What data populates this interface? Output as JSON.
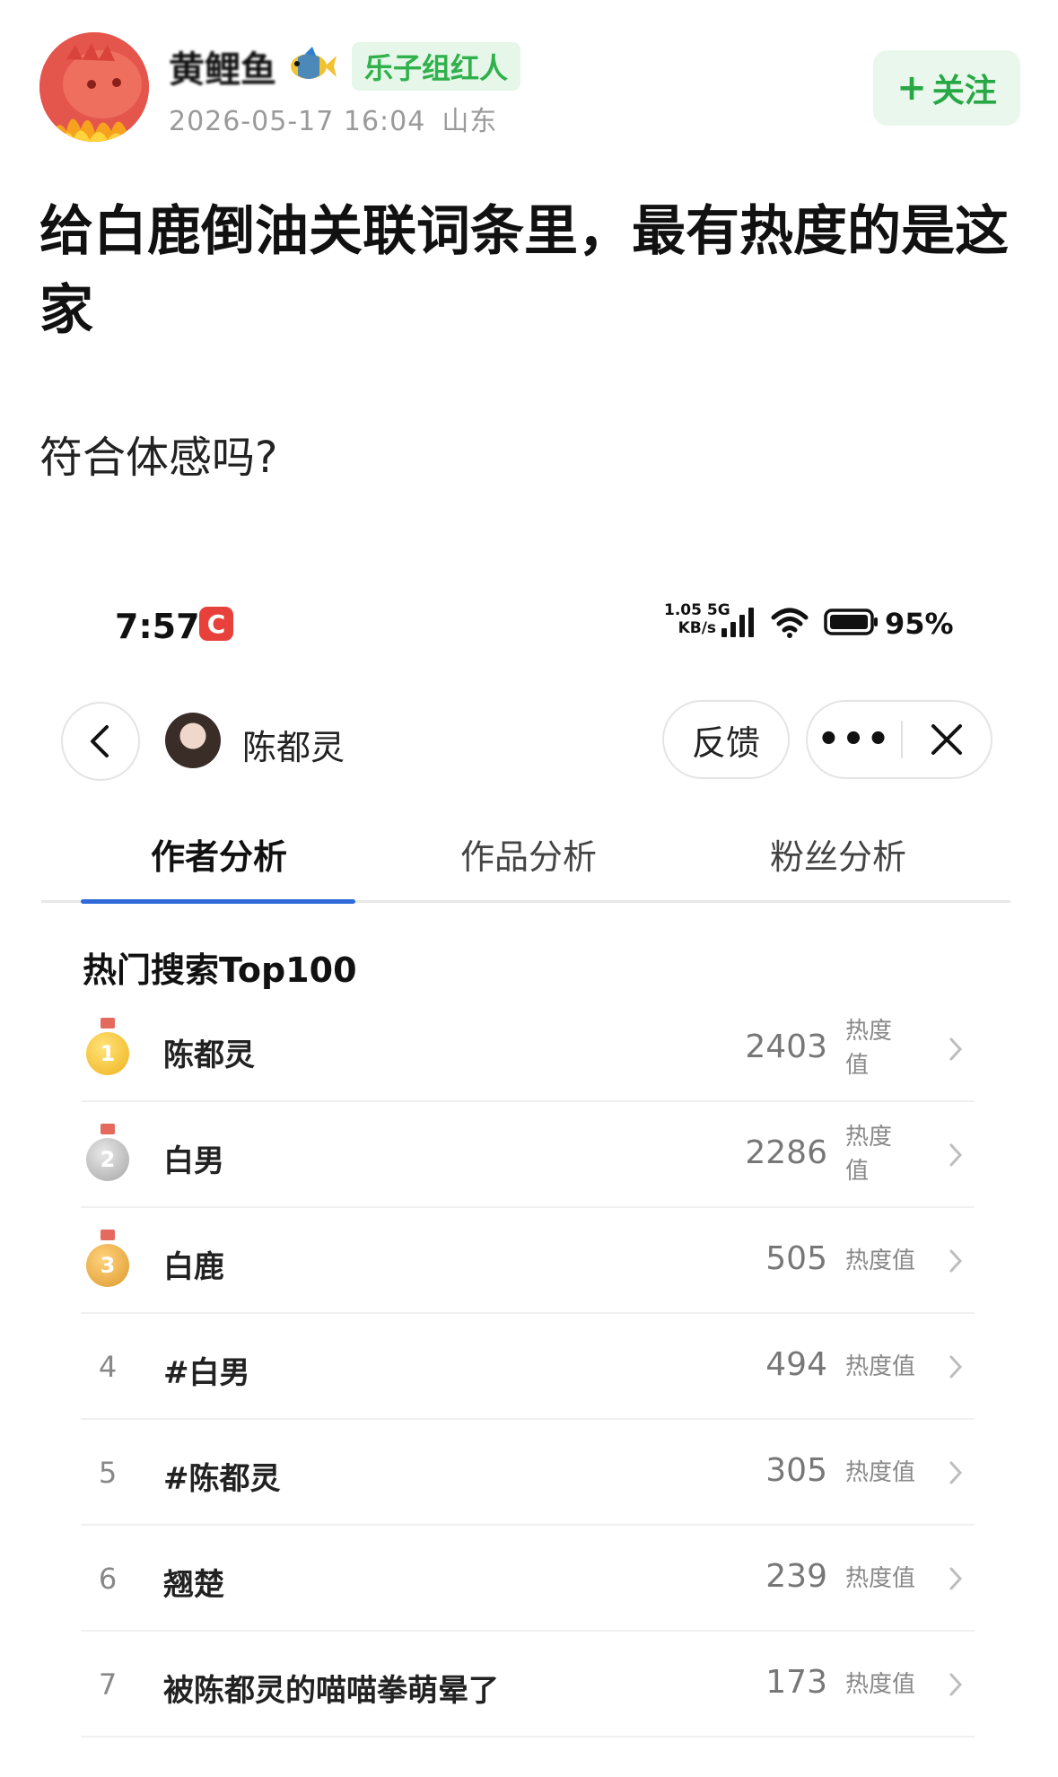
{
  "post": {
    "username": "黄鲤鱼",
    "user_tag": "乐子组红人",
    "date": "2026-05-17 16:04",
    "location": "山东",
    "follow_label": "关注",
    "follow_plus": "+",
    "title": "给白鹿倒油关联词条里，最有热度的是这家",
    "body": "符合体感吗?"
  },
  "screenshot": {
    "status_bar": {
      "time": "7:57",
      "app_badge": "C",
      "net_speed_line1": "1.05",
      "net_speed_line2": "KB/s",
      "network": "5G",
      "battery": "95%"
    },
    "nav": {
      "name": "陈都灵",
      "feedback_label": "反馈",
      "more_label": "•••"
    },
    "tabs": [
      {
        "label": "作者分析",
        "active": true
      },
      {
        "label": "作品分析",
        "active": false
      },
      {
        "label": "粉丝分析",
        "active": false
      }
    ],
    "section_title": "热门搜索Top100",
    "rows": [
      {
        "rank": "1",
        "medal": "gold",
        "keyword": "陈都灵",
        "value": "2403",
        "unit": "热度值"
      },
      {
        "rank": "2",
        "medal": "silver",
        "keyword": "白男",
        "value": "2286",
        "unit": "热度值"
      },
      {
        "rank": "3",
        "medal": "bronze",
        "keyword": "白鹿",
        "value": "505",
        "unit": "热度值"
      },
      {
        "rank": "4",
        "medal": "",
        "keyword": "#白男",
        "value": "494",
        "unit": "热度值"
      },
      {
        "rank": "5",
        "medal": "",
        "keyword": "#陈都灵",
        "value": "305",
        "unit": "热度值"
      },
      {
        "rank": "6",
        "medal": "",
        "keyword": "翘楚",
        "value": "239",
        "unit": "热度值"
      },
      {
        "rank": "7",
        "medal": "",
        "keyword": "被陈都灵的喵喵拳萌晕了",
        "value": "173",
        "unit": "热度值"
      }
    ]
  },
  "colors": {
    "accent_green": "#27a844",
    "tab_underline": "#2f6bd8",
    "badge_red": "#e8413b"
  }
}
